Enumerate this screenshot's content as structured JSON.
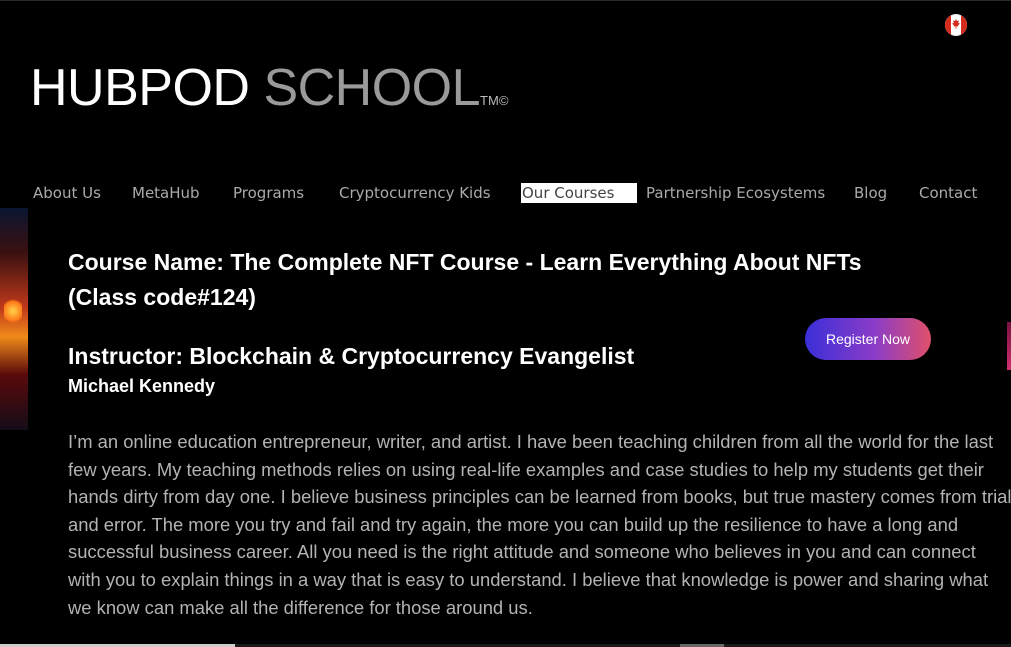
{
  "brand": {
    "word1": "HUBPOD",
    "word2": "SCHOOL",
    "mark": "TM©"
  },
  "locale_flag_icon": "canada-flag-icon",
  "nav": {
    "items": [
      {
        "label": "About Us",
        "active": false
      },
      {
        "label": "MetaHub",
        "active": false
      },
      {
        "label": "Programs",
        "active": false
      },
      {
        "label": "Cryptocurrency Kids",
        "active": false
      },
      {
        "label": "Our Courses",
        "active": true
      },
      {
        "label": "Partnership Ecosystems",
        "active": false
      },
      {
        "label": "Blog",
        "active": false
      },
      {
        "label": "Contact",
        "active": false
      }
    ]
  },
  "course": {
    "name": "Course Name: The Complete NFT Course - Learn Everything About NFTs",
    "class_code": "(Class code#124)"
  },
  "instructor": {
    "heading": "Instructor: Blockchain & Cryptocurrency Evangelist",
    "name": "Michael Kennedy",
    "bio": "I’m an online education entrepreneur, writer, and artist. I have been teaching children from all the world for the last few years.  My teaching methods relies on using real-life examples and case studies to help my students get their hands dirty from day one. I believe business principles can be learned from books, but true mastery comes from trial and error. The more you try and fail and try again, the more you can build up the resilience to have a long and successful business career. All you need is the right attitude and someone who believes in you and can connect with you to explain things in a way that is easy to understand. I believe that knowledge is power and sharing what we know can make all the difference for those around us."
  },
  "cta": {
    "register_label": "Register Now"
  },
  "colors": {
    "background": "#000000",
    "nav_text": "#aaaaaa",
    "bio_text": "#b3b3b3",
    "button_gradient_start": "#3a2fd8",
    "button_gradient_end": "#e0506a"
  }
}
